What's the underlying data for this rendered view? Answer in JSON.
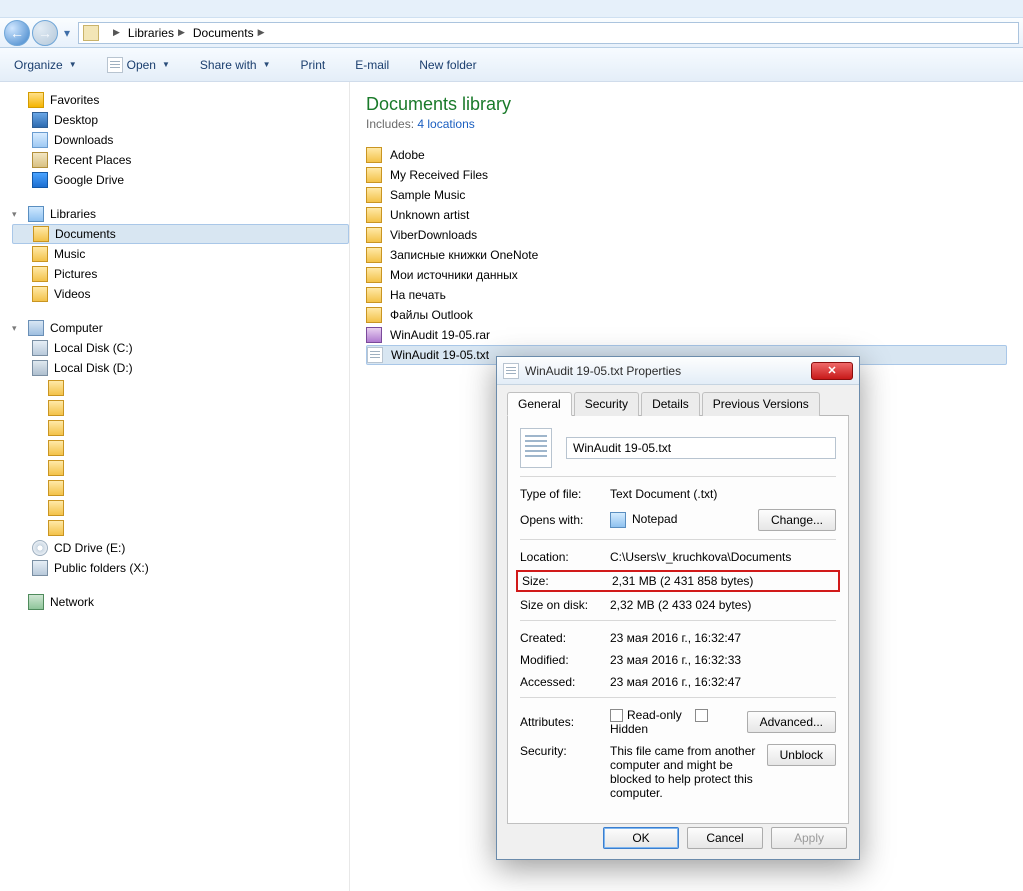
{
  "breadcrumb": {
    "root": "Libraries",
    "current": "Documents"
  },
  "toolbar": {
    "organize": "Organize",
    "open": "Open",
    "share": "Share with",
    "print": "Print",
    "email": "E-mail",
    "newfolder": "New folder"
  },
  "nav": {
    "favorites": "Favorites",
    "desktop": "Desktop",
    "downloads": "Downloads",
    "recent": "Recent Places",
    "gdrive": "Google Drive",
    "libraries": "Libraries",
    "documents": "Documents",
    "music": "Music",
    "pictures": "Pictures",
    "videos": "Videos",
    "computer": "Computer",
    "localc": "Local Disk (C:)",
    "locald": "Local Disk (D:)",
    "cddrive": "CD Drive (E:)",
    "publicx": "Public folders (X:)",
    "network": "Network"
  },
  "library": {
    "title": "Documents library",
    "includes_prefix": "Includes:",
    "includes_link": "4 locations"
  },
  "files": [
    "Adobe",
    "My Received Files",
    "Sample Music",
    "Unknown artist",
    "ViberDownloads",
    "Записные книжки OneNote",
    "Мои источники данных",
    "На печать",
    "Файлы Outlook",
    "WinAudit 19-05.rar",
    "WinAudit 19-05.txt"
  ],
  "dialog": {
    "title": "WinAudit 19-05.txt Properties",
    "tabs": {
      "general": "General",
      "security": "Security",
      "details": "Details",
      "prev": "Previous Versions"
    },
    "filename": "WinAudit 19-05.txt",
    "typeoffile_lbl": "Type of file:",
    "typeoffile_val": "Text Document (.txt)",
    "opens_lbl": "Opens with:",
    "opens_val": "Notepad",
    "change_btn": "Change...",
    "location_lbl": "Location:",
    "location_val": "C:\\Users\\v_kruchkova\\Documents",
    "size_lbl": "Size:",
    "size_val": "2,31 MB (2 431 858 bytes)",
    "sizedisk_lbl": "Size on disk:",
    "sizedisk_val": "2,32 MB (2 433 024 bytes)",
    "created_lbl": "Created:",
    "created_val": "23 мая 2016 г., 16:32:47",
    "modified_lbl": "Modified:",
    "modified_val": "23 мая 2016 г., 16:32:33",
    "accessed_lbl": "Accessed:",
    "accessed_val": "23 мая 2016 г., 16:32:47",
    "attributes_lbl": "Attributes:",
    "readonly": "Read-only",
    "hidden": "Hidden",
    "advanced_btn": "Advanced...",
    "security_lbl": "Security:",
    "security_text": "This file came from another computer and might be blocked to help protect this computer.",
    "unblock_btn": "Unblock",
    "ok": "OK",
    "cancel": "Cancel",
    "apply": "Apply"
  }
}
